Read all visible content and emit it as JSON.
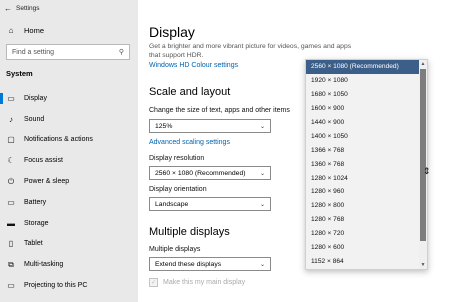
{
  "window": {
    "title": "Settings"
  },
  "sidebar": {
    "home_label": "Home",
    "search_placeholder": "Find a setting",
    "section_label": "System",
    "items": [
      {
        "label": "Display",
        "icon": "monitor-icon",
        "glyph": "▭",
        "active": true
      },
      {
        "label": "Sound",
        "icon": "speaker-icon",
        "glyph": "♪"
      },
      {
        "label": "Notifications & actions",
        "icon": "notifications-icon",
        "glyph": "▢"
      },
      {
        "label": "Focus assist",
        "icon": "moon-icon",
        "glyph": "☾"
      },
      {
        "label": "Power & sleep",
        "icon": "power-icon",
        "glyph": "⏻"
      },
      {
        "label": "Battery",
        "icon": "battery-icon",
        "glyph": "▭"
      },
      {
        "label": "Storage",
        "icon": "storage-icon",
        "glyph": "▬"
      },
      {
        "label": "Tablet",
        "icon": "tablet-icon",
        "glyph": "▯"
      },
      {
        "label": "Multi-tasking",
        "icon": "multitasking-icon",
        "glyph": "⧉"
      },
      {
        "label": "Projecting to this PC",
        "icon": "projecting-icon",
        "glyph": "▭"
      }
    ]
  },
  "main": {
    "title": "Display",
    "description": "Get a brighter and more vibrant picture for videos, games and apps that support HDR.",
    "hdr_link": "Windows HD Colour settings",
    "scale_heading": "Scale and layout",
    "scale_label": "Change the size of text, apps and other items",
    "scale_value": "125%",
    "advanced_link": "Advanced scaling settings",
    "resolution_label": "Display resolution",
    "resolution_value": "2560 × 1080 (Recommended)",
    "orientation_label": "Display orientation",
    "orientation_value": "Landscape",
    "multiple_heading": "Multiple displays",
    "multiple_label": "Multiple displays",
    "multiple_value": "Extend these displays",
    "main_display_label": "Make this my main display"
  },
  "resolution_options": [
    "2560 × 1080 (Recommended)",
    "1920 × 1080",
    "1680 × 1050",
    "1600 × 900",
    "1440 × 900",
    "1400 × 1050",
    "1366 × 768",
    "1360 × 768",
    "1280 × 1024",
    "1280 × 960",
    "1280 × 800",
    "1280 × 768",
    "1280 × 720",
    "1280 × 600",
    "1152 × 864"
  ],
  "selected_option_index": 0,
  "colors": {
    "accent": "#0078d7",
    "selected_row": "#3c5f8a",
    "link": "#0063b1"
  }
}
